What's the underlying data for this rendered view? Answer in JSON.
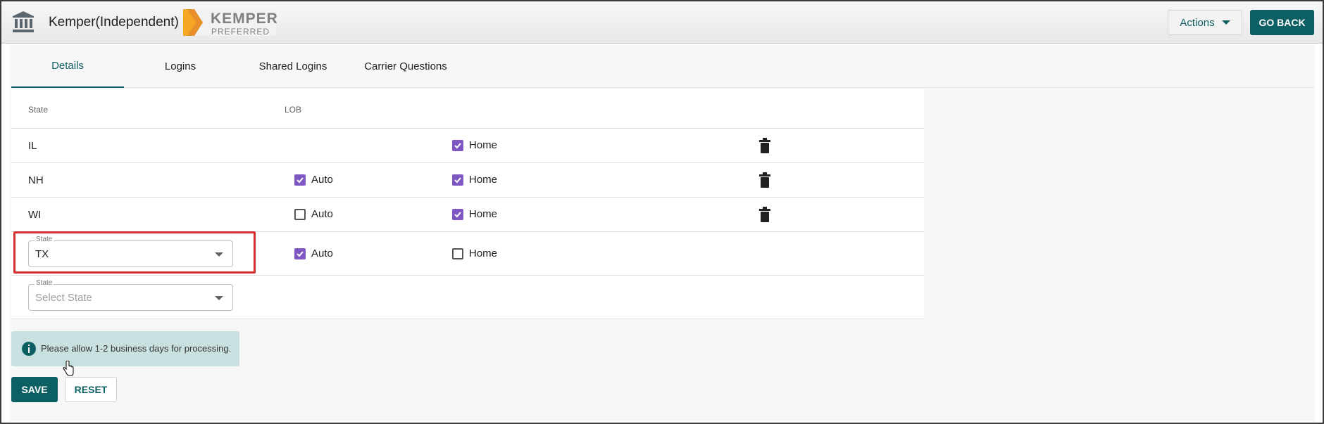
{
  "header": {
    "carrier_title": "Kemper(Independent)",
    "logo_line1": "KEMPER",
    "logo_line2": "PREFERRED",
    "actions_label": "Actions",
    "go_back_label": "GO BACK"
  },
  "tabs": [
    {
      "label": "Details",
      "active": true
    },
    {
      "label": "Logins",
      "active": false
    },
    {
      "label": "Shared Logins",
      "active": false
    },
    {
      "label": "Carrier Questions",
      "active": false
    }
  ],
  "table": {
    "headers": {
      "state": "State",
      "lob": "LOB"
    },
    "rows": [
      {
        "state": "IL",
        "auto": null,
        "home": {
          "label": "Home",
          "checked": true
        }
      },
      {
        "state": "NH",
        "auto": {
          "label": "Auto",
          "checked": true
        },
        "home": {
          "label": "Home",
          "checked": true
        }
      },
      {
        "state": "WI",
        "auto": {
          "label": "Auto",
          "checked": false
        },
        "home": {
          "label": "Home",
          "checked": true
        }
      }
    ],
    "edit_row": {
      "state_field_label": "State",
      "state_value": "TX",
      "auto": {
        "label": "Auto",
        "checked": true
      },
      "home": {
        "label": "Home",
        "checked": false
      }
    },
    "new_row": {
      "state_field_label": "State",
      "state_placeholder": "Select State"
    }
  },
  "info_banner": {
    "text": "Please allow 1-2 business days for processing."
  },
  "footer": {
    "save_label": "SAVE",
    "reset_label": "RESET"
  },
  "colors": {
    "primary": "#0c5f63",
    "checkbox": "#7e57c2",
    "highlight": "#d32f2f",
    "info_bg": "#c8e0df"
  }
}
